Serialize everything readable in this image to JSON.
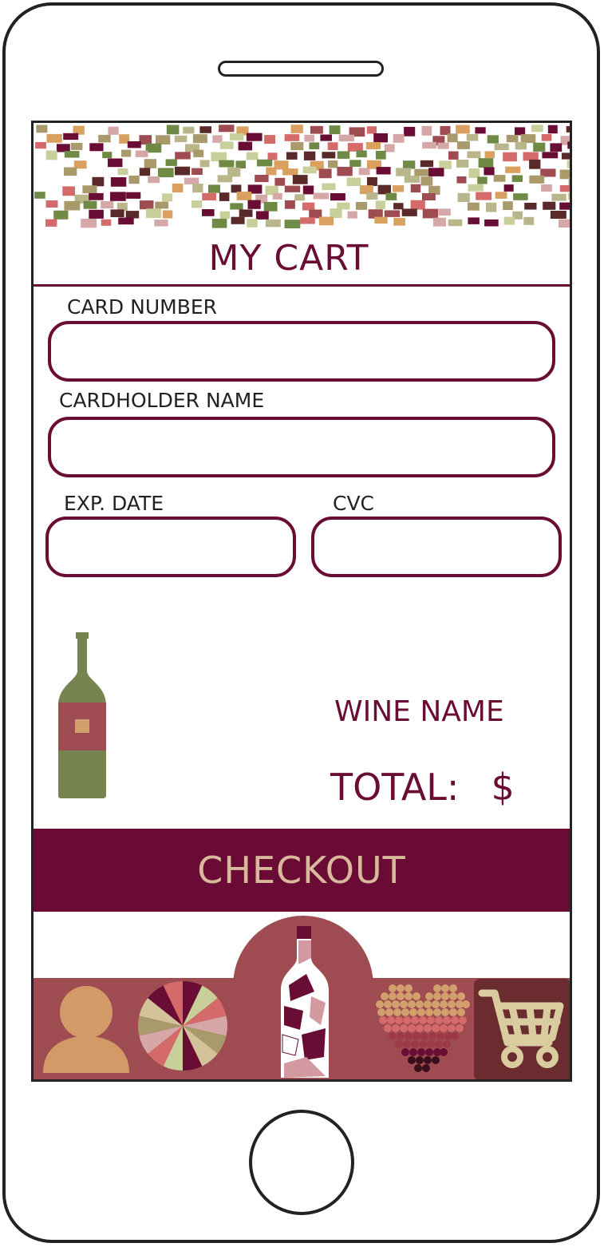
{
  "screen": {
    "title": "MY CART"
  },
  "form": {
    "card_number": {
      "label": "CARD NUMBER",
      "value": "",
      "placeholder": ""
    },
    "cardholder_name": {
      "label": "CARDHOLDER NAME",
      "value": "",
      "placeholder": ""
    },
    "exp_date": {
      "label": "EXP. DATE",
      "value": "",
      "placeholder": ""
    },
    "cvc": {
      "label": "CVC",
      "value": "",
      "placeholder": ""
    }
  },
  "cart_item": {
    "name": "WINE NAME",
    "total_label": "TOTAL:",
    "currency": "$"
  },
  "checkout": {
    "label": "CHECKOUT"
  },
  "bottom_nav": {
    "items": [
      {
        "icon": "profile-icon",
        "active": false
      },
      {
        "icon": "wine-wheel-icon",
        "active": false
      },
      {
        "icon": "wine-bottle-icon",
        "active": false
      },
      {
        "icon": "grape-heart-icon",
        "active": false
      },
      {
        "icon": "shopping-cart-icon",
        "active": true
      }
    ]
  },
  "colors": {
    "brand": "#6a0d34",
    "checkout_text": "#d9b99b",
    "nav_background": "#9e4c51",
    "nav_active": "#6b2c2f"
  }
}
